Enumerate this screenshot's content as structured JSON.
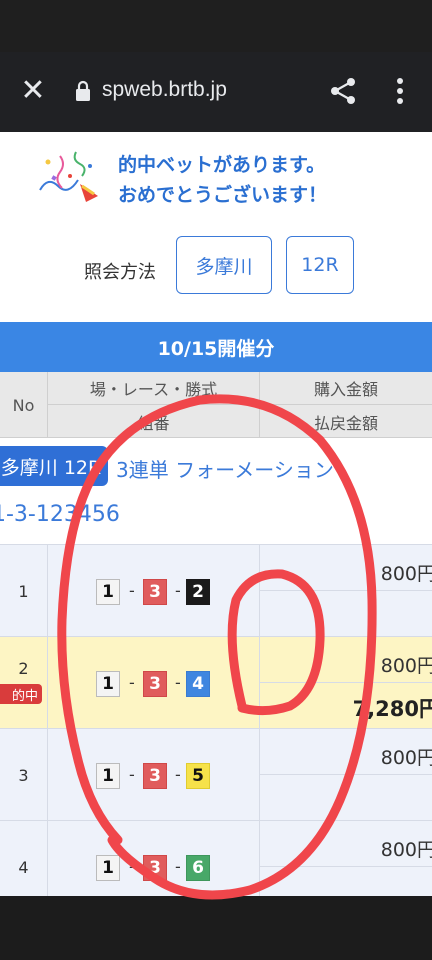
{
  "browser": {
    "url": "spweb.brtb.jp",
    "close_icon": "close-icon",
    "lock_icon": "lock-icon",
    "share_icon": "share-icon",
    "more_icon": "more-vert-icon"
  },
  "congrats": {
    "line1": "的中ベットがあります。",
    "line2": "おめでとうございます！",
    "icon": "party-popper-icon"
  },
  "lookup": {
    "label": "照会方法",
    "venue": "多摩川",
    "race": "12R"
  },
  "date_header": "10/15開催分",
  "table_headers": {
    "no": "No",
    "venue_race_type": "場・レース・勝式",
    "combination": "組番",
    "purchase_amount": "購入金額",
    "payout_amount": "払戻金額"
  },
  "bet": {
    "venue_race": "多摩川 12R",
    "bet_type": "3連単 フォーメーション",
    "combo": "1-3-123456"
  },
  "rows": [
    {
      "no": "1",
      "c1": "1",
      "c2": "3",
      "c3": "2",
      "amount": "800円",
      "payout": "",
      "hit": false
    },
    {
      "no": "2",
      "c1": "1",
      "c2": "3",
      "c3": "4",
      "amount": "800円",
      "payout": "7,280円",
      "hit": true,
      "badge": "的中"
    },
    {
      "no": "3",
      "c1": "1",
      "c2": "3",
      "c3": "5",
      "amount": "800円",
      "payout": "",
      "hit": false
    },
    {
      "no": "4",
      "c1": "1",
      "c2": "3",
      "c3": "6",
      "amount": "800円",
      "payout": "",
      "hit": false
    }
  ],
  "colors": {
    "accent_blue": "#3a86e4",
    "win_row": "#fdf5c4",
    "hit_badge": "#d93c3c",
    "scribble": "#f0464b"
  }
}
